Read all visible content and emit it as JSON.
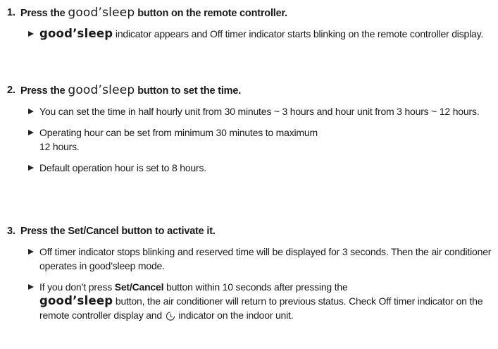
{
  "steps": [
    {
      "number": "1.",
      "title": {
        "pre": "Press the ",
        "brand": "good’sleep",
        "post": " button on the remote controller."
      },
      "bullets": [
        {
          "brand": "good’sleep",
          "text": " indicator appears and Off timer indicator starts blinking on the remote controller display."
        }
      ]
    },
    {
      "number": "2.",
      "title": {
        "pre": "Press the ",
        "brand": "good’sleep",
        "post": " button to set the time."
      },
      "bullets": [
        {
          "text": "You can set the time in half hourly unit from 30 minutes ~ 3 hours and hour unit from 3 hours ~ 12 hours."
        },
        {
          "text1": "Operating hour can be set from minimum 30 minutes to maximum",
          "text2": "12 hours."
        },
        {
          "text": "Default operation hour is set to 8 hours."
        }
      ]
    },
    {
      "number": "3.",
      "title": {
        "pre": "Press the ",
        "bold": "Set/Cancel",
        "post": " button to activate it."
      },
      "bullets": [
        {
          "text": "Off timer indicator stops blinking and reserved time will be displayed for 3 seconds. Then the air conditioner operates in good’sleep mode."
        },
        {
          "pre": "If you don’t press ",
          "bold": "Set/Cancel",
          "mid": " button within 10 seconds after pressing the",
          "brand": "good’sleep",
          "post": " button, the air conditioner will return to previous status. Check Off timer indicator on the remote controller display and ",
          "icon": "timer-icon",
          "end": " indicator on the indoor unit."
        }
      ]
    }
  ]
}
